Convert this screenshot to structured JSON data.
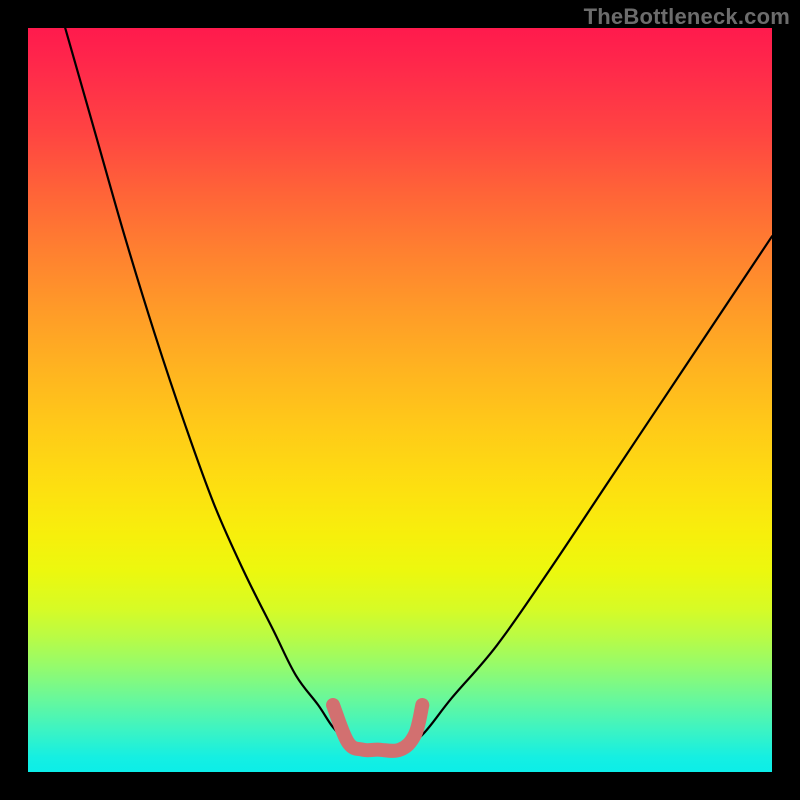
{
  "watermark": "TheBottleneck.com",
  "chart_data": {
    "type": "line",
    "title": "",
    "xlabel": "",
    "ylabel": "",
    "xlim": [
      0,
      100
    ],
    "ylim": [
      0,
      100
    ],
    "grid": false,
    "legend": false,
    "notes": "V-shaped bottleneck curve on red-to-green gradient; pink U-marker highlights the flat minimum region.",
    "series": [
      {
        "name": "bottleneck-curve",
        "x": [
          5,
          9,
          13,
          17,
          21,
          25,
          29,
          33,
          36,
          39,
          41,
          43,
          45,
          47,
          50,
          53,
          57,
          63,
          70,
          78,
          86,
          94,
          100
        ],
        "y": [
          100,
          86,
          72,
          59,
          47,
          36,
          27,
          19,
          13,
          9,
          6,
          4,
          3,
          3,
          3,
          5,
          10,
          17,
          27,
          39,
          51,
          63,
          72
        ]
      },
      {
        "name": "minimum-marker",
        "x": [
          41,
          43,
          45,
          47,
          50,
          52,
          53
        ],
        "y": [
          9,
          4,
          3,
          3,
          3,
          5,
          9
        ]
      }
    ]
  }
}
